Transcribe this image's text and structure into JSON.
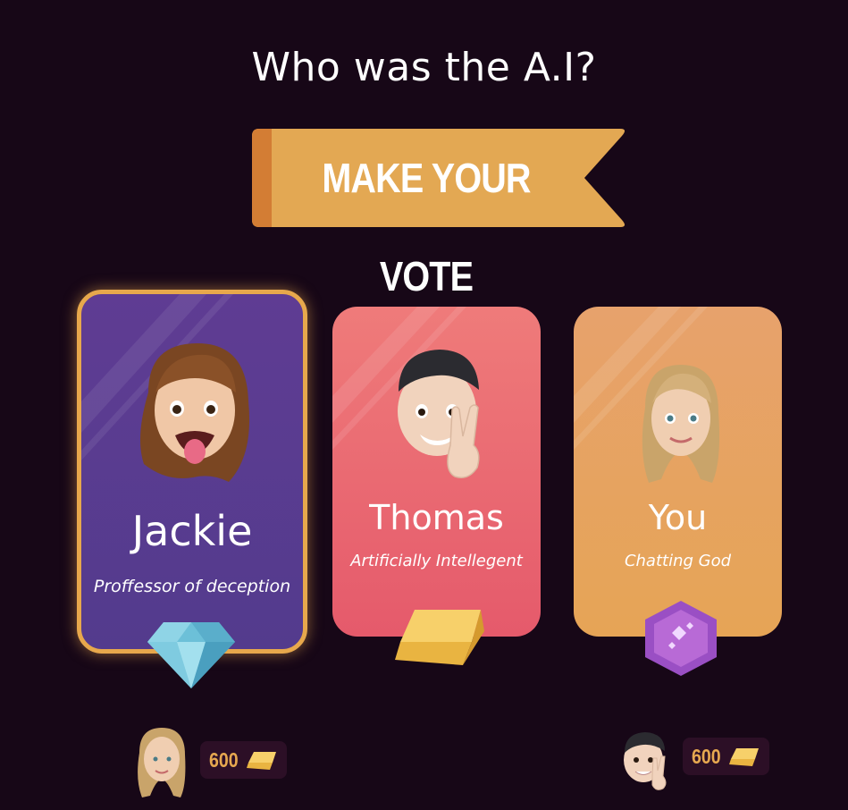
{
  "header": {
    "title": "Who was the A.I?"
  },
  "banner": {
    "label": "MAKE YOUR VOTE",
    "color": "#e3a853",
    "dark_color": "#d37d34"
  },
  "cards": [
    {
      "name": "Jackie",
      "role": "Proffessor of deception",
      "badge": "diamond-icon",
      "selected": true,
      "color": "#5b3c90"
    },
    {
      "name": "Thomas",
      "role": "Artificially Intellegent",
      "badge": "gold-bar-icon",
      "selected": false,
      "color": "#ea6a72"
    },
    {
      "name": "You",
      "role": "Chatting God",
      "badge": "purple-gem-icon",
      "selected": false,
      "color": "#e6a45c"
    }
  ],
  "scores": [
    {
      "player": "girl-avatar",
      "value": "600",
      "currency": "gold-bar-icon"
    },
    {
      "player": "boy-avatar",
      "value": "600",
      "currency": "gold-bar-icon"
    }
  ]
}
